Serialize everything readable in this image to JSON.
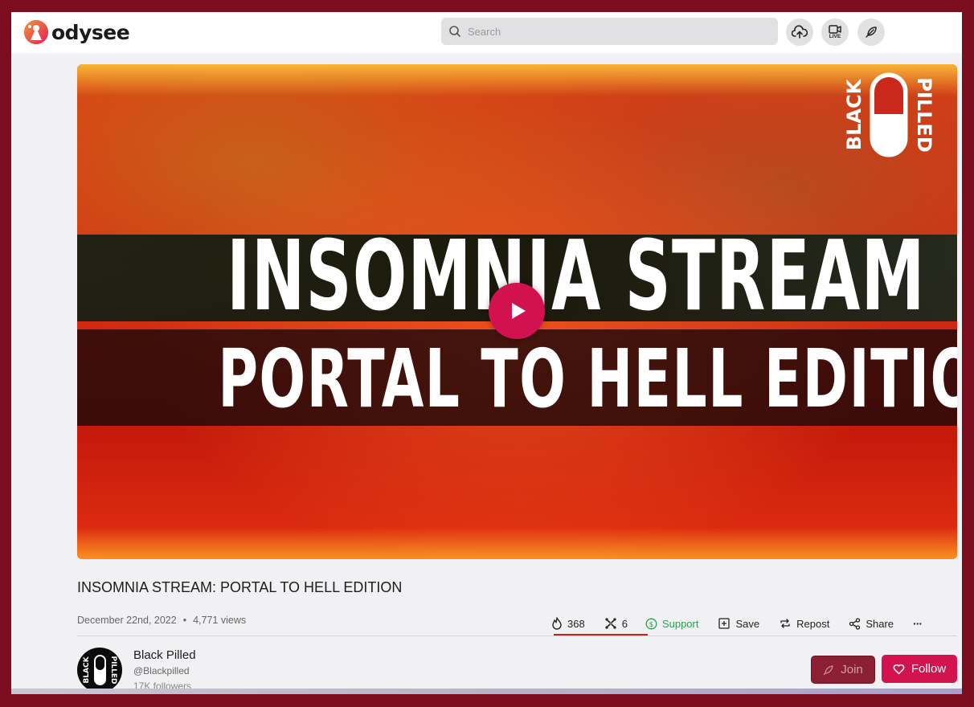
{
  "header": {
    "logo_text": "odysee",
    "search_placeholder": "Search",
    "live_label": "LIVE"
  },
  "video": {
    "title_line1": "INSOMNIA STREAM",
    "title_line2": "PORTAL TO HELL EDITION",
    "brand_left": "BLACK",
    "brand_right": "PILLED"
  },
  "details": {
    "title": "INSOMNIA STREAM: PORTAL TO HELL EDITION",
    "date": "December 22nd, 2022",
    "separator": "•",
    "views": "4,771 views"
  },
  "actions": {
    "fire_count": "368",
    "slime_count": "6",
    "support_label": "Support",
    "save_label": "Save",
    "repost_label": "Repost",
    "share_label": "Share",
    "more_label": "···"
  },
  "channel": {
    "name": "Black Pilled",
    "handle": "@Blackpilled",
    "followers": "17K followers",
    "avatar_left": "BLACK",
    "avatar_right": "PILLED",
    "join_label": "Join",
    "follow_label": "Follow"
  },
  "colors": {
    "frame": "#7a0e1e",
    "accent": "#d2134f",
    "support": "#2c9e4f"
  }
}
